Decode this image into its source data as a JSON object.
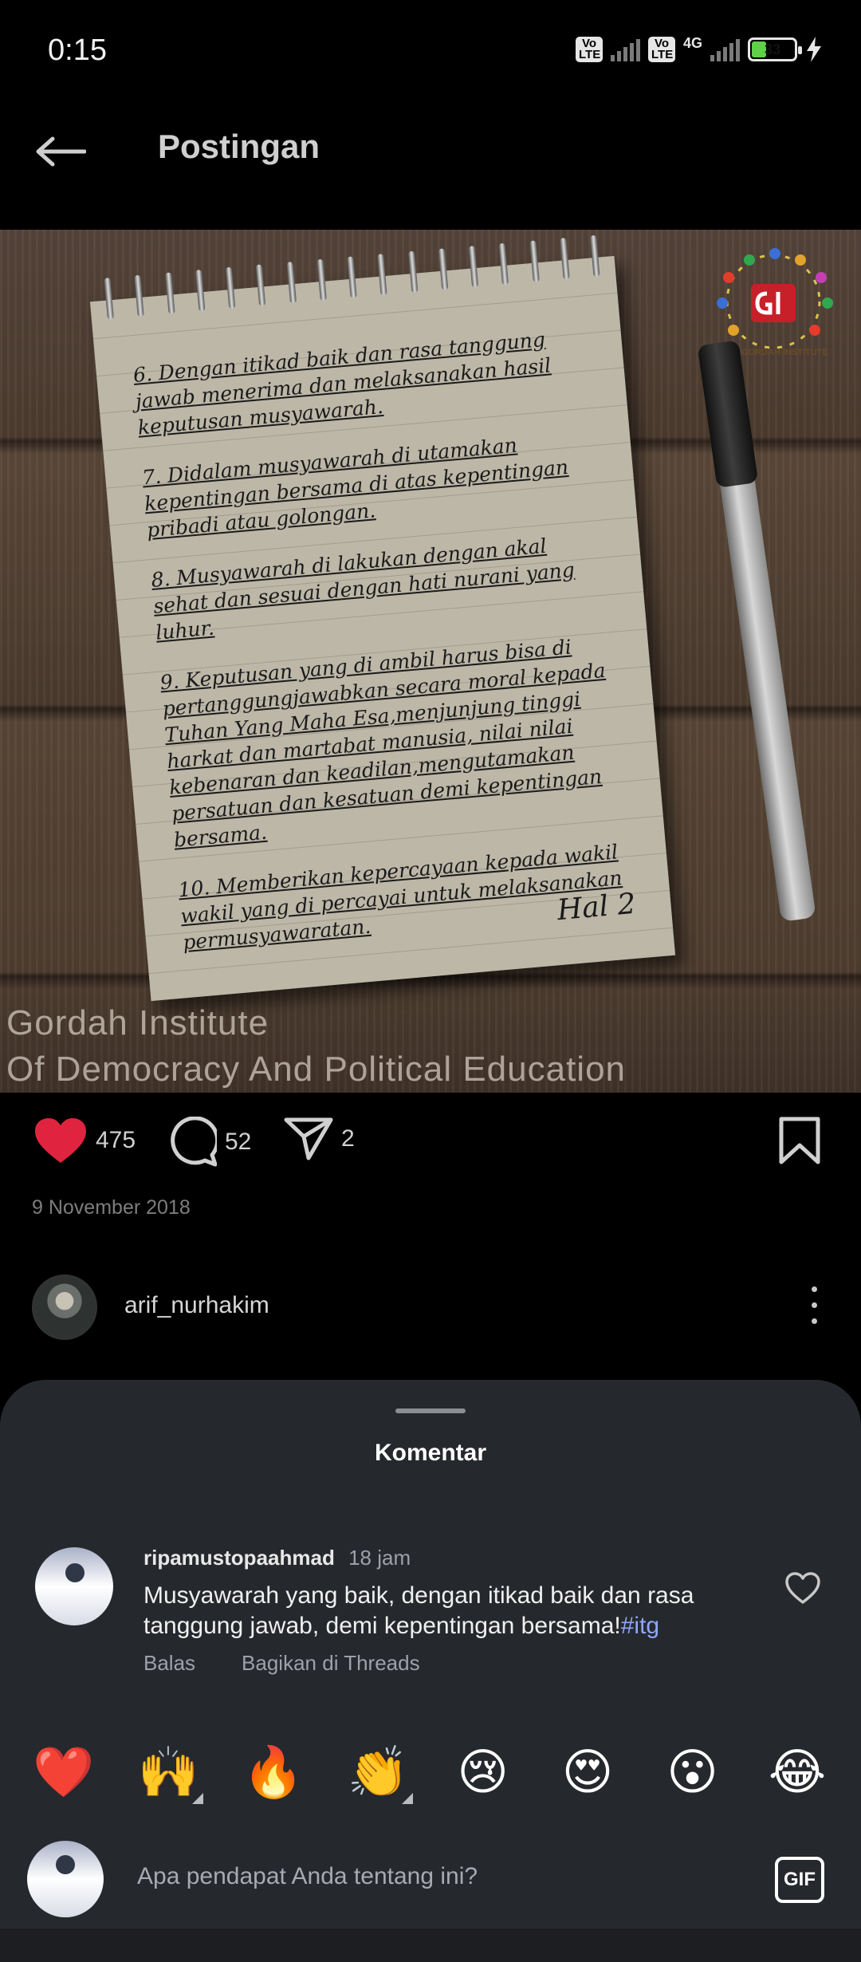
{
  "status_bar": {
    "time": "0:15",
    "sim1": "VoLTE",
    "sim2": "VoLTE",
    "network": "4G",
    "battery": "33"
  },
  "header": {
    "title": "Postingan",
    "back_icon": "arrow-left-icon"
  },
  "post": {
    "notepad_items": [
      "6. Dengan itikad baik dan rasa tanggung jawab menerima dan melaksanakan hasil keputusan musyawarah.",
      "7. Didalam musyawarah di utamakan kepentingan bersama di atas kepentingan pribadi atau golongan.",
      "8. Musyawarah di lakukan dengan akal sehat dan sesuai dengan hati nurani yang luhur.",
      "9. Keputusan yang di ambil harus bisa di pertanggungjawabkan secara moral kepada Tuhan Yang Maha Esa,menjunjung tinggi harkat dan martabat manusia, nilai nilai kebenaran dan keadilan,mengutamakan persatuan dan kesatuan demi kepentingan bersama.",
      "10. Memberikan kepercayaan kepada wakil wakil yang di percayai untuk melaksanakan permusyawaratan."
    ],
    "notepad_page": "Hal 2",
    "watermark_line1": "Gordah Institute",
    "watermark_line2": "Of Democracy And Political Education",
    "logo_text": "GORDAH INSTITUTE",
    "likes": "475",
    "comments": "52",
    "shares": "2",
    "date": "9 November 2018",
    "author": "arif_nurhakim"
  },
  "comment_sheet": {
    "title": "Komentar",
    "comment": {
      "user": "ripamustopaahmad",
      "time": "18 jam",
      "text": "Musyawarah yang baik, dengan itikad baik dan rasa tanggung jawab, demi kepentingan bersama!",
      "hashtag": "#itg",
      "reply": "Balas",
      "share_threads": "Bagikan di Threads"
    },
    "emojis": [
      "❤️",
      "🙌",
      "🔥",
      "👏",
      "😢",
      "😍",
      "😮",
      "😂"
    ],
    "input_placeholder": "Apa pendapat Anda tentang ini?",
    "gif_label": "GIF"
  },
  "colors": {
    "like_red": "#e0243f",
    "hashtag": "#8fa6ff",
    "sheet_bg": "#25282d"
  }
}
